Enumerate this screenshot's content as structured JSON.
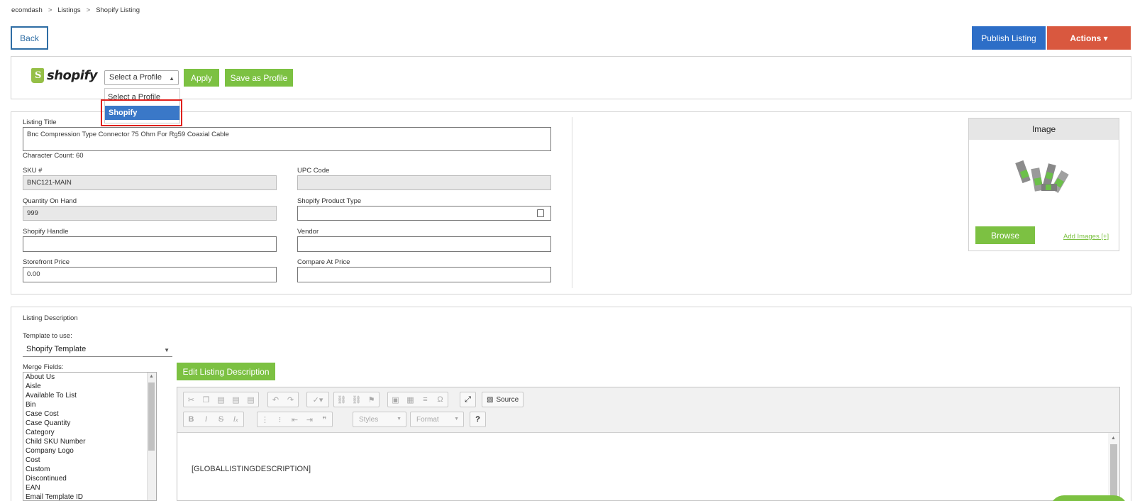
{
  "breadcrumb": {
    "items": [
      "ecomdash",
      "Listings",
      "Shopify Listing"
    ],
    "separator": ">"
  },
  "header": {
    "back_label": "Back",
    "publish_label": "Publish Listing",
    "actions_label": "Actions ▾"
  },
  "profile": {
    "logo_text": "shopify",
    "selected": "Select a Profile",
    "apply_label": "Apply",
    "save_profile_label": "Save as Profile",
    "options": [
      "Select a Profile",
      "Shopify"
    ],
    "highlighted_option": "Shopify"
  },
  "listing": {
    "title_label": "Listing Title",
    "title_value": "Bnc Compression Type Connector 75 Ohm For Rg59 Coaxial Cable",
    "char_count_label": "Character Count: 60",
    "sku_label": "SKU #",
    "sku_value": "BNC121-MAIN",
    "upc_label": "UPC Code",
    "upc_value": "",
    "qty_label": "Quantity On Hand",
    "qty_value": "999",
    "product_type_label": "Shopify Product Type",
    "product_type_value": "",
    "handle_label": "Shopify Handle",
    "handle_value": "",
    "vendor_label": "Vendor",
    "vendor_value": "",
    "price_label": "Storefront Price",
    "price_value": "0.00",
    "compare_label": "Compare At Price",
    "compare_value": ""
  },
  "image": {
    "header": "Image",
    "browse_label": "Browse",
    "add_images_label": "Add Images [+]"
  },
  "description": {
    "section_label": "Listing Description",
    "template_label": "Template to use:",
    "template_value": "Shopify Template",
    "merge_label": "Merge Fields:",
    "merge_fields": [
      "About Us",
      "Aisle",
      "Available To List",
      "Bin",
      "Case Cost",
      "Case Quantity",
      "Category",
      "Child SKU Number",
      "Company Logo",
      "Cost",
      "Custom",
      "Discontinued",
      "EAN",
      "Email Template ID"
    ],
    "edit_label": "Edit Listing Description",
    "source_label": "Source",
    "styles_label": "Styles",
    "format_label": "Format",
    "help_label": "?",
    "body_text": "[GLOBALLISTINGDESCRIPTION]"
  },
  "colors": {
    "primary_blue": "#2d6ec7",
    "actions_orange": "#d9583f",
    "green": "#7cc142",
    "highlight_red": "#e0201b"
  }
}
